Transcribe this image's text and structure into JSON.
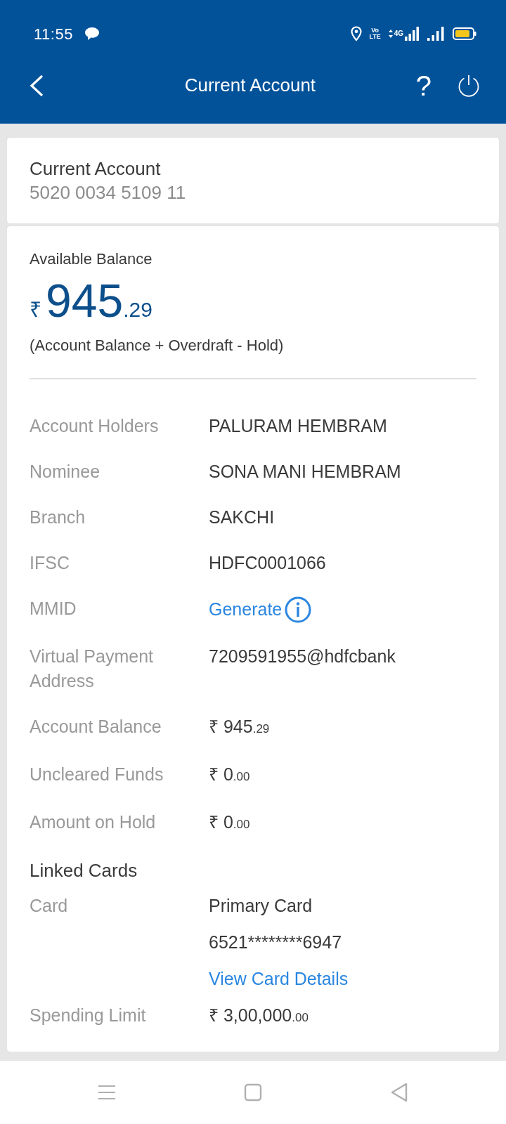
{
  "status_bar": {
    "time": "11:55",
    "volte_label": "Vo LTE",
    "data_label": "4G"
  },
  "header": {
    "title": "Current Account",
    "help_symbol": "?"
  },
  "account": {
    "type": "Current Account",
    "number": "5020 0034 5109 11"
  },
  "balance": {
    "label": "Available Balance",
    "amount": {
      "currency": "₹",
      "whole": "945",
      "fraction": ".29"
    },
    "note": "(Account Balance + Overdraft - Hold)"
  },
  "details": [
    {
      "label": "Account Holders",
      "kind": "text",
      "value": "PALURAM HEMBRAM"
    },
    {
      "label": "Nominee",
      "kind": "text",
      "value": "SONA MANI HEMBRAM"
    },
    {
      "label": "Branch",
      "kind": "text",
      "value": "SAKCHI"
    },
    {
      "label": "IFSC",
      "kind": "text",
      "value": "HDFC0001066"
    },
    {
      "label": "MMID",
      "kind": "action",
      "value": "Generate"
    },
    {
      "label": "Virtual Payment Address",
      "kind": "text",
      "value": "7209591955@hdfcbank"
    },
    {
      "label": "Account Balance",
      "kind": "amount",
      "amount": {
        "currency": "₹",
        "whole": "945",
        "fraction": ".29"
      }
    },
    {
      "label": "Uncleared Funds",
      "kind": "amount",
      "amount": {
        "currency": "₹",
        "whole": "0",
        "fraction": ".00"
      }
    },
    {
      "label": "Amount on Hold",
      "kind": "amount",
      "amount": {
        "currency": "₹",
        "whole": "0",
        "fraction": ".00"
      }
    }
  ],
  "linked_cards": {
    "heading": "Linked Cards",
    "rows": [
      {
        "label": "Card",
        "lines": [
          {
            "kind": "text",
            "text": "Primary Card"
          },
          {
            "kind": "text",
            "text": "6521********6947"
          },
          {
            "kind": "link",
            "text": "View Card Details"
          }
        ]
      },
      {
        "label": "Spending Limit",
        "lines": [
          {
            "kind": "amount",
            "amount": {
              "currency": "₹",
              "whole": "3,00,000",
              "fraction": ".00"
            }
          }
        ]
      }
    ]
  }
}
